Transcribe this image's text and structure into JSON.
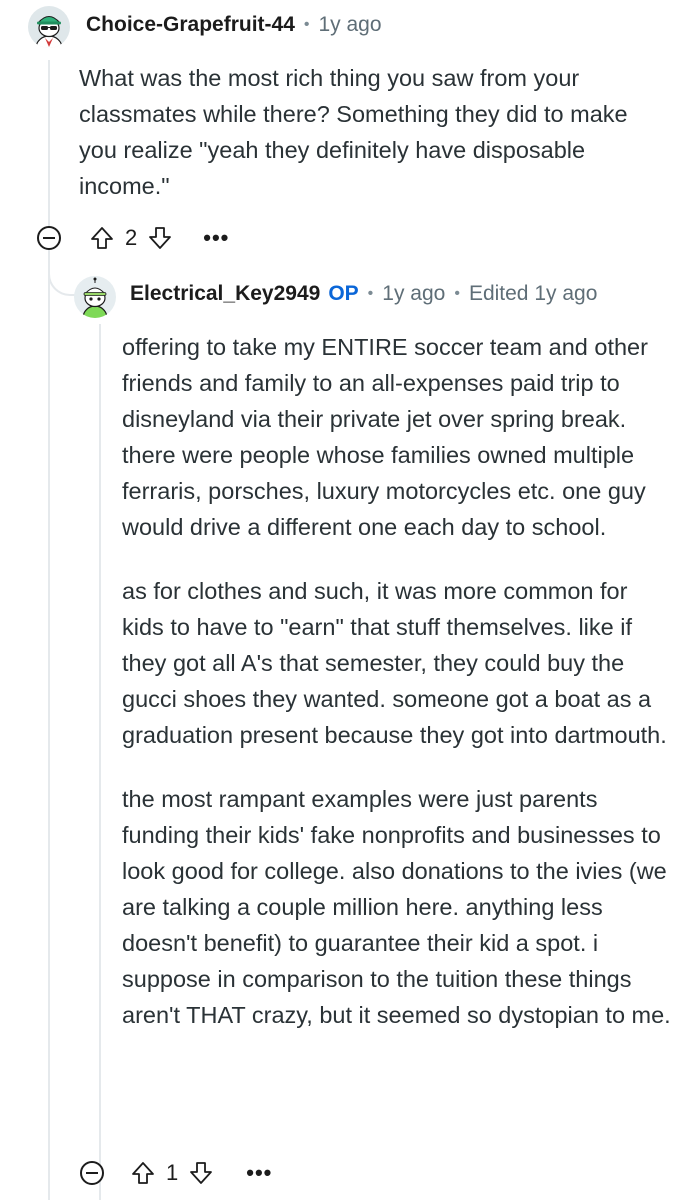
{
  "comment": {
    "author": "Choice-Grapefruit-44",
    "time": "1y ago",
    "body": [
      "What was the most rich thing you saw from your classmates while there? Something they did to make you realize \"yeah they definitely have disposable income.\""
    ],
    "score": "2",
    "more": "•••"
  },
  "reply": {
    "author": "Electrical_Key2949",
    "badge": "OP",
    "time": "1y ago",
    "edited": "Edited 1y ago",
    "body": [
      "offering to take my ENTIRE soccer team and other friends and family to an all-expenses paid trip to disneyland via their private jet over spring break. there were people whose families owned multiple ferraris, porsches, luxury motorcycles etc. one guy would drive a different one each day to school.",
      "as for clothes and such, it was more common for kids to have to \"earn\" that stuff themselves. like if they got all A's that semester, they could buy the gucci shoes they wanted. someone got a boat as a graduation present because they got into dartmouth.",
      "the most rampant examples were just parents funding their kids' fake nonprofits and businesses to look good for college. also donations to the ivies (we are talking a couple million here. anything less doesn't benefit) to guarantee their kid a spot. i suppose in comparison to the tuition these things aren't THAT crazy, but it seemed so dystopian to me."
    ],
    "score": "1",
    "more": "•••"
  },
  "separator": "•",
  "icons": {
    "avatar_1": "snoo-avatar-green-cap-sunglasses",
    "avatar_2": "snoo-avatar-green-cap",
    "collapse": "collapse-thread-icon",
    "upvote": "upvote-arrow-icon",
    "downvote": "downvote-arrow-icon",
    "more": "more-options-icon"
  },
  "colors": {
    "op_badge": "#0a66d8",
    "thread_line": "#e5e9ec",
    "meta_text": "#5f6e77"
  }
}
